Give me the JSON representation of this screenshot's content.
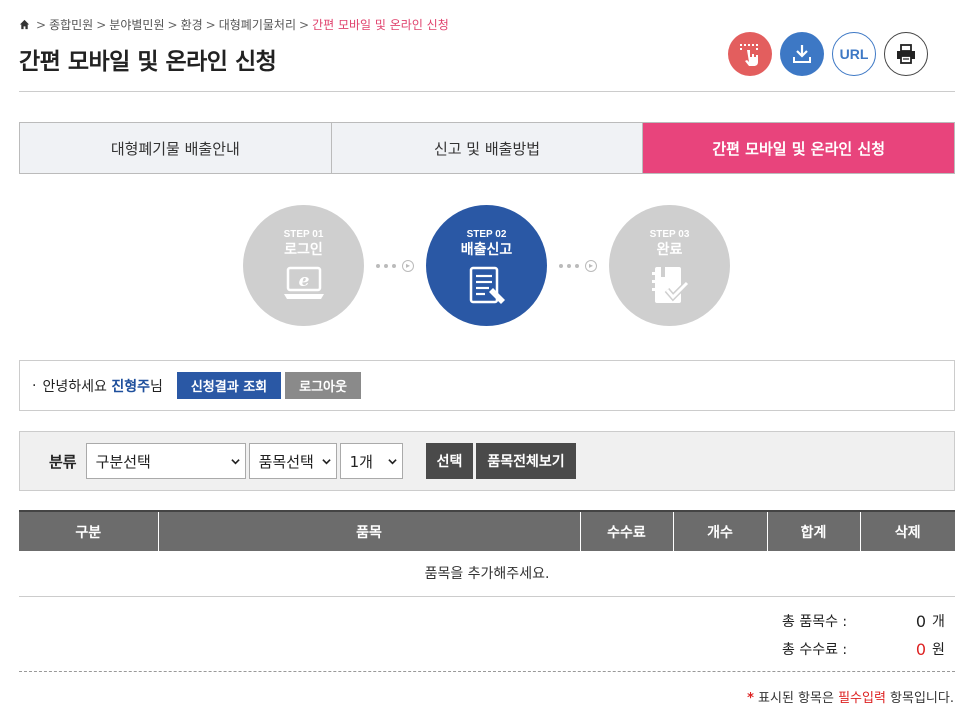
{
  "breadcrumb": {
    "items": [
      "종합민원",
      "분야별민원",
      "환경",
      "대형폐기물처리"
    ],
    "current": "간편 모바일 및 온라인 신청",
    "separator": ">"
  },
  "page_title": "간편 모바일 및 온라인 신청",
  "tools": {
    "url_label": "URL"
  },
  "tabs": [
    {
      "label": "대형폐기물 배출안내",
      "active": false
    },
    {
      "label": "신고 및 배출방법",
      "active": false
    },
    {
      "label": "간편 모바일 및 온라인 신청",
      "active": true
    }
  ],
  "steps": [
    {
      "num": "STEP 01",
      "label": "로그인",
      "icon": "laptop-e-icon",
      "active": false
    },
    {
      "num": "STEP 02",
      "label": "배출신고",
      "icon": "document-pen-icon",
      "active": true
    },
    {
      "num": "STEP 03",
      "label": "완료",
      "icon": "notebook-check-icon",
      "active": false
    }
  ],
  "user": {
    "bullet": "·",
    "greeting": "안녕하세요",
    "name": "진형주",
    "suffix": "님",
    "result_button": "신청결과 조회",
    "logout_button": "로그아웃"
  },
  "filter": {
    "label": "분류",
    "category_value": "구분선택",
    "item_value": "품목선택",
    "count_value": "1개",
    "select_button": "선택",
    "view_all_button": "품목전체보기"
  },
  "table": {
    "headers": [
      "구분",
      "품목",
      "수수료",
      "개수",
      "합계",
      "삭제"
    ],
    "empty_message": "품목을 추가해주세요."
  },
  "totals": {
    "items_label": "총 품목수 :",
    "items_value": "0",
    "items_unit": "개",
    "fee_label": "총 수수료 :",
    "fee_value": "0",
    "fee_unit": "원"
  },
  "note": {
    "star": "*",
    "pre": " 표시된 항목은 ",
    "required": "필수입력",
    "post": " 항목입니다."
  },
  "colors": {
    "accent_pink": "#e8447c",
    "accent_blue": "#2a58a5",
    "step_inactive": "#cfcfcf",
    "required_red": "#dd2222"
  }
}
